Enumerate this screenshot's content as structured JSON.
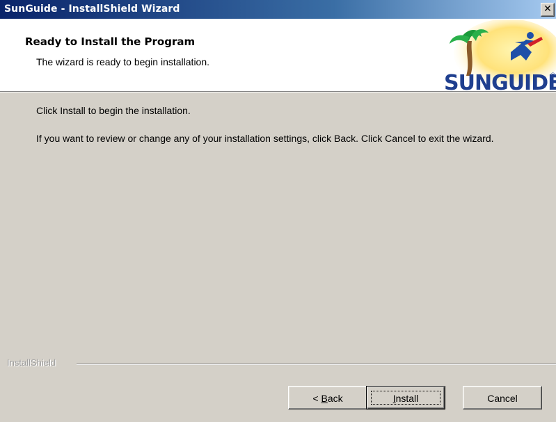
{
  "window": {
    "title": "SunGuide - InstallShield Wizard",
    "close_label": "✕"
  },
  "header": {
    "title": "Ready to Install the Program",
    "subtitle": "The wizard is ready to begin installation.",
    "logo_text": "SUNGUIDE",
    "logo_mark": "®"
  },
  "body": {
    "line1": "Click Install to begin the installation.",
    "line2": "If you want to review or change any of your installation settings, click Back. Click Cancel to exit the wizard."
  },
  "footer": {
    "brand": "InstallShield",
    "buttons": {
      "back_prefix": "< ",
      "back_mnemonic": "B",
      "back_rest": "ack",
      "install_mnemonic": "I",
      "install_rest": "nstall",
      "cancel": "Cancel"
    }
  },
  "colors": {
    "titlebar_start": "#0a246a",
    "titlebar_end": "#a6caf0",
    "dialog_bg": "#d4d0c8",
    "logo_text": "#1f3f8f"
  }
}
